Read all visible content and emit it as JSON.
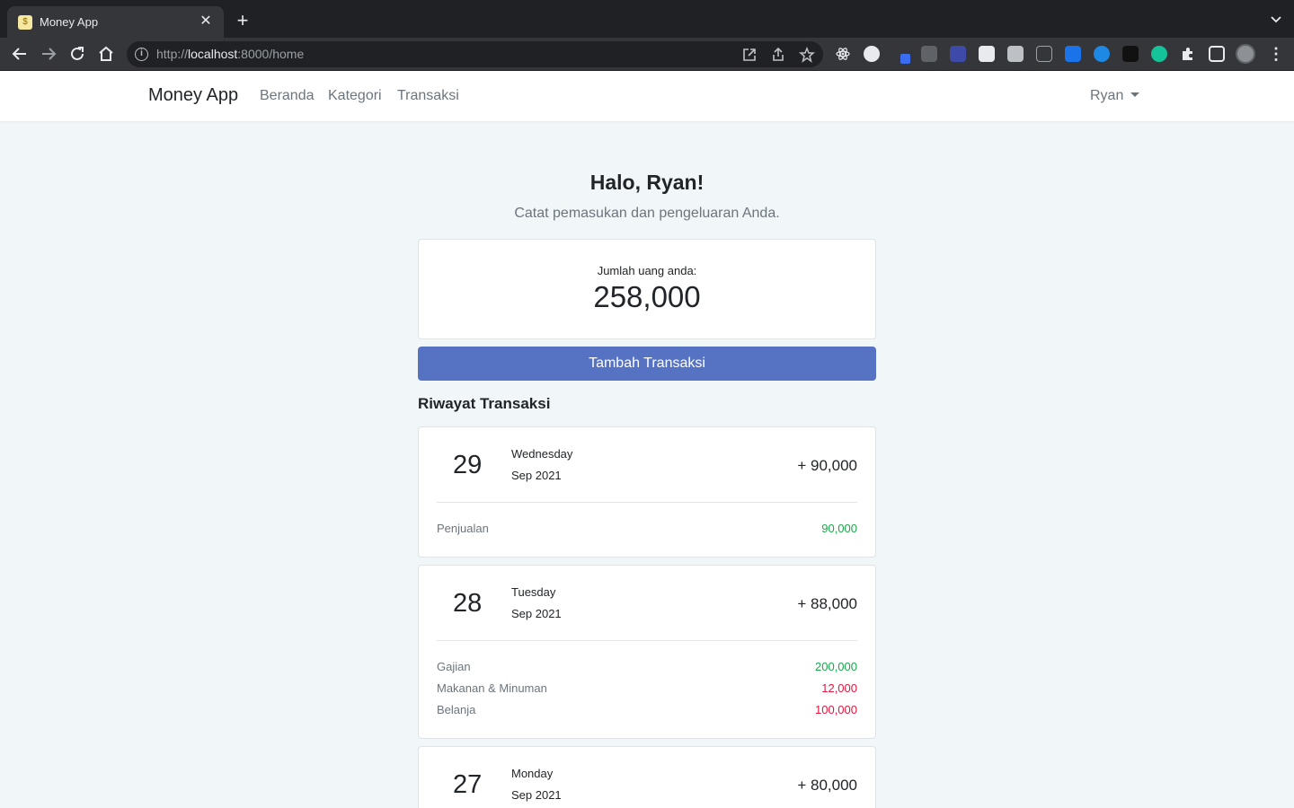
{
  "browser": {
    "tab_title": "Money App",
    "url_scheme": "http://",
    "url_host": "localhost",
    "url_rest": ":8000/home"
  },
  "navbar": {
    "brand": "Money App",
    "links": [
      "Beranda",
      "Kategori",
      "Transaksi"
    ],
    "user": "Ryan"
  },
  "main": {
    "greeting": "Halo, Ryan!",
    "subtitle": "Catat pemasukan dan pengeluaran Anda.",
    "balance_label": "Jumlah uang anda:",
    "balance_value": "258,000",
    "add_button": "Tambah Transaksi",
    "history_title": "Riwayat Transaksi"
  },
  "days": [
    {
      "day": "29",
      "weekday": "Wednesday",
      "month": "Sep 2021",
      "total": "+ 90,000",
      "transactions": [
        {
          "category": "Penjualan",
          "amount": "90,000",
          "type": "income"
        }
      ]
    },
    {
      "day": "28",
      "weekday": "Tuesday",
      "month": "Sep 2021",
      "total": "+ 88,000",
      "transactions": [
        {
          "category": "Gajian",
          "amount": "200,000",
          "type": "income"
        },
        {
          "category": "Makanan & Minuman",
          "amount": "12,000",
          "type": "expense"
        },
        {
          "category": "Belanja",
          "amount": "100,000",
          "type": "expense"
        }
      ]
    },
    {
      "day": "27",
      "weekday": "Monday",
      "month": "Sep 2021",
      "total": "+ 80,000",
      "transactions": []
    }
  ],
  "colors": {
    "income": "#1aa64a",
    "expense": "#e3163e",
    "primary_button": "#5672c2",
    "page_background": "#f1f6f9"
  }
}
